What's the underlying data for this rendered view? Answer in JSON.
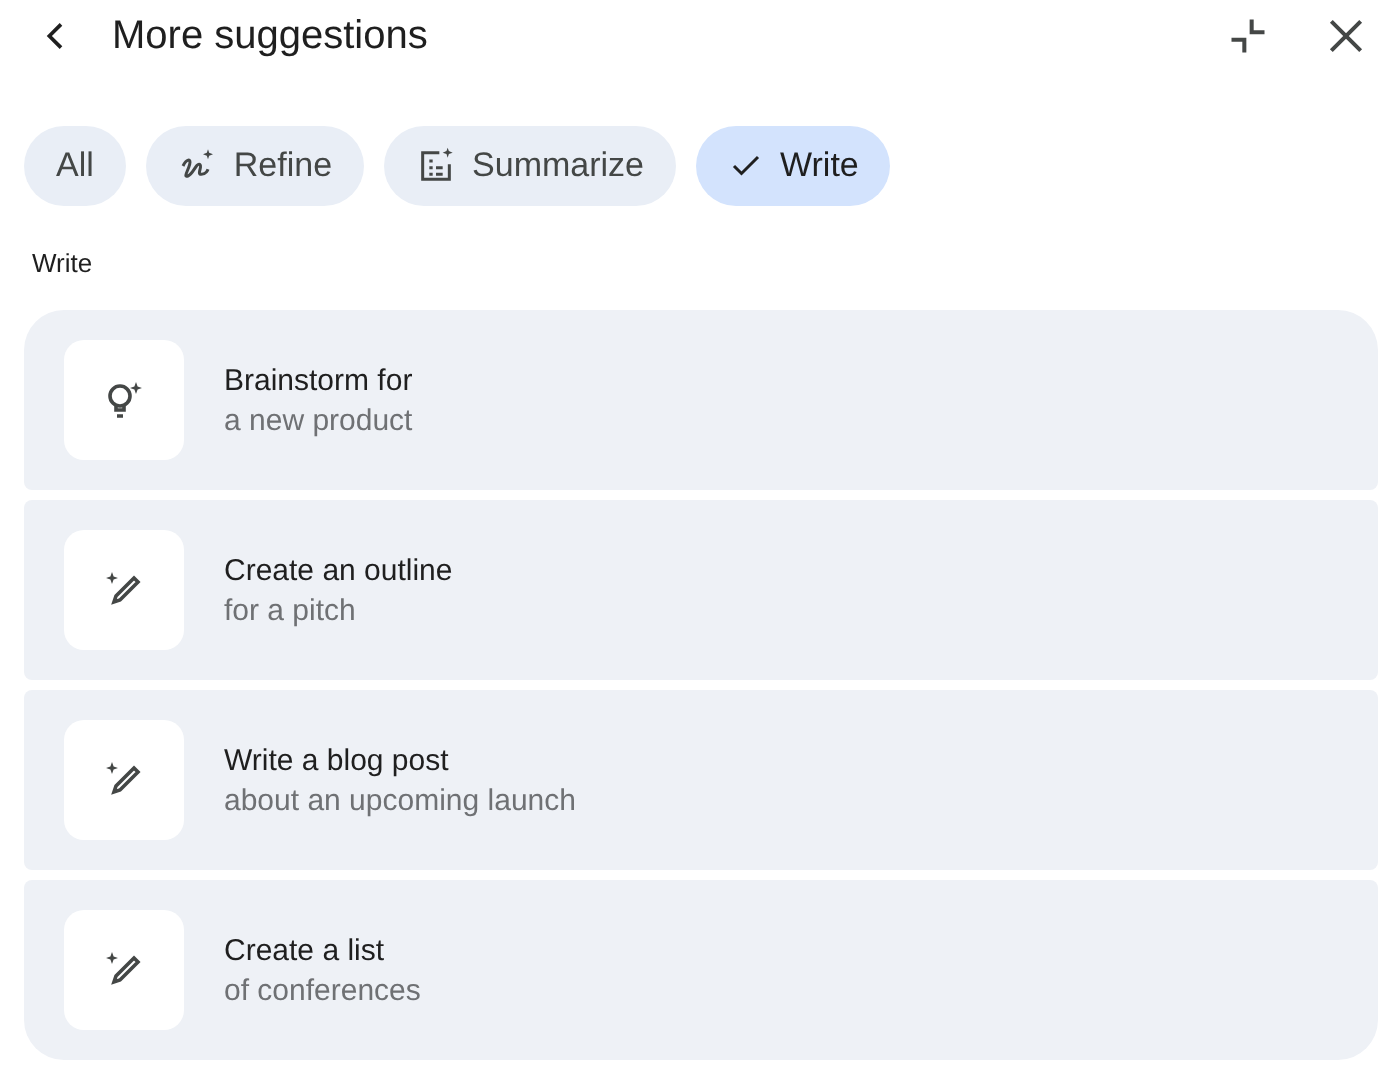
{
  "header": {
    "title": "More suggestions"
  },
  "chips": [
    {
      "label": "All",
      "kind": "plain",
      "selected": false
    },
    {
      "label": "Refine",
      "kind": "refine",
      "selected": false
    },
    {
      "label": "Summarize",
      "kind": "summarize",
      "selected": false
    },
    {
      "label": "Write",
      "kind": "check",
      "selected": true
    }
  ],
  "section_label": "Write",
  "suggestions": [
    {
      "kind": "bulb",
      "title": "Brainstorm for",
      "subtitle": "a new product"
    },
    {
      "kind": "pen",
      "title": "Create an outline",
      "subtitle": "for a pitch"
    },
    {
      "kind": "pen",
      "title": "Write a blog post",
      "subtitle": "about an upcoming launch"
    },
    {
      "kind": "pen",
      "title": "Create a list",
      "subtitle": "of conferences"
    }
  ]
}
